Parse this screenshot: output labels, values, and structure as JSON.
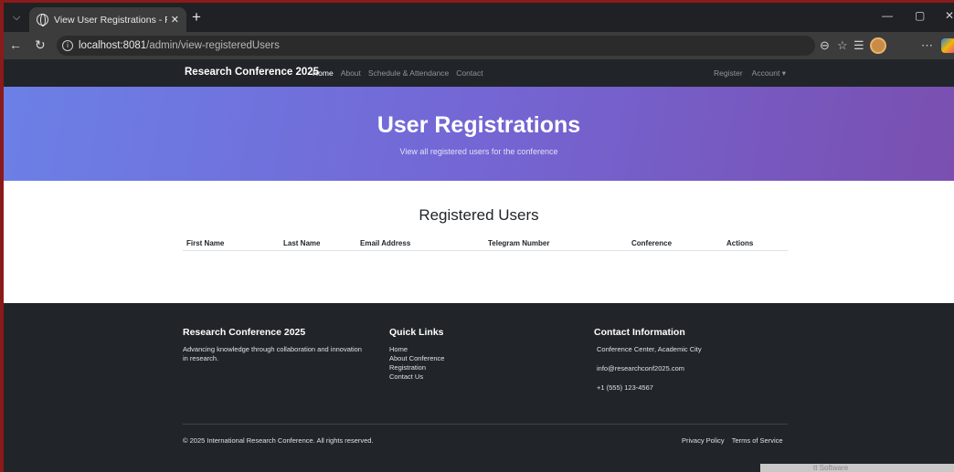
{
  "browser": {
    "tab_title": "View User Registrations - Researc",
    "url_host": "localhost:8081",
    "url_path": "/admin/view-registeredUsers"
  },
  "navbar": {
    "brand": "Research Conference 2025",
    "links": [
      {
        "label": "Home",
        "active": true
      },
      {
        "label": "About"
      },
      {
        "label": "Schedule & Attendance"
      },
      {
        "label": "Contact"
      }
    ],
    "register": "Register",
    "account": "Account ▾"
  },
  "hero": {
    "title": "User Registrations",
    "subtitle": "View all registered users for the conference"
  },
  "content": {
    "heading": "Registered Users",
    "columns": [
      "First Name",
      "Last Name",
      "Email Address",
      "Telegram Number",
      "Conference",
      "Actions"
    ]
  },
  "footer": {
    "about_title": "Research Conference 2025",
    "about_text": "Advancing knowledge through collaboration and innovation in research.",
    "quick_title": "Quick Links",
    "quick_links": [
      "Home",
      "About Conference",
      "Registration",
      "Contact Us"
    ],
    "contact_title": "Contact Information",
    "contact_lines": [
      "Conference Center, Academic City",
      "info@researchconf2025.com",
      "+1 (555) 123-4567"
    ],
    "copyright": "© 2025 International Research Conference. All rights reserved.",
    "privacy": "Privacy Policy",
    "terms": "Terms of Service"
  },
  "watermark": "tt Software",
  "colors": {
    "hero_start": "#6b80e6",
    "hero_end": "#7a4fb0",
    "navbar_bg": "#212529",
    "footer_bg": "#212529"
  }
}
